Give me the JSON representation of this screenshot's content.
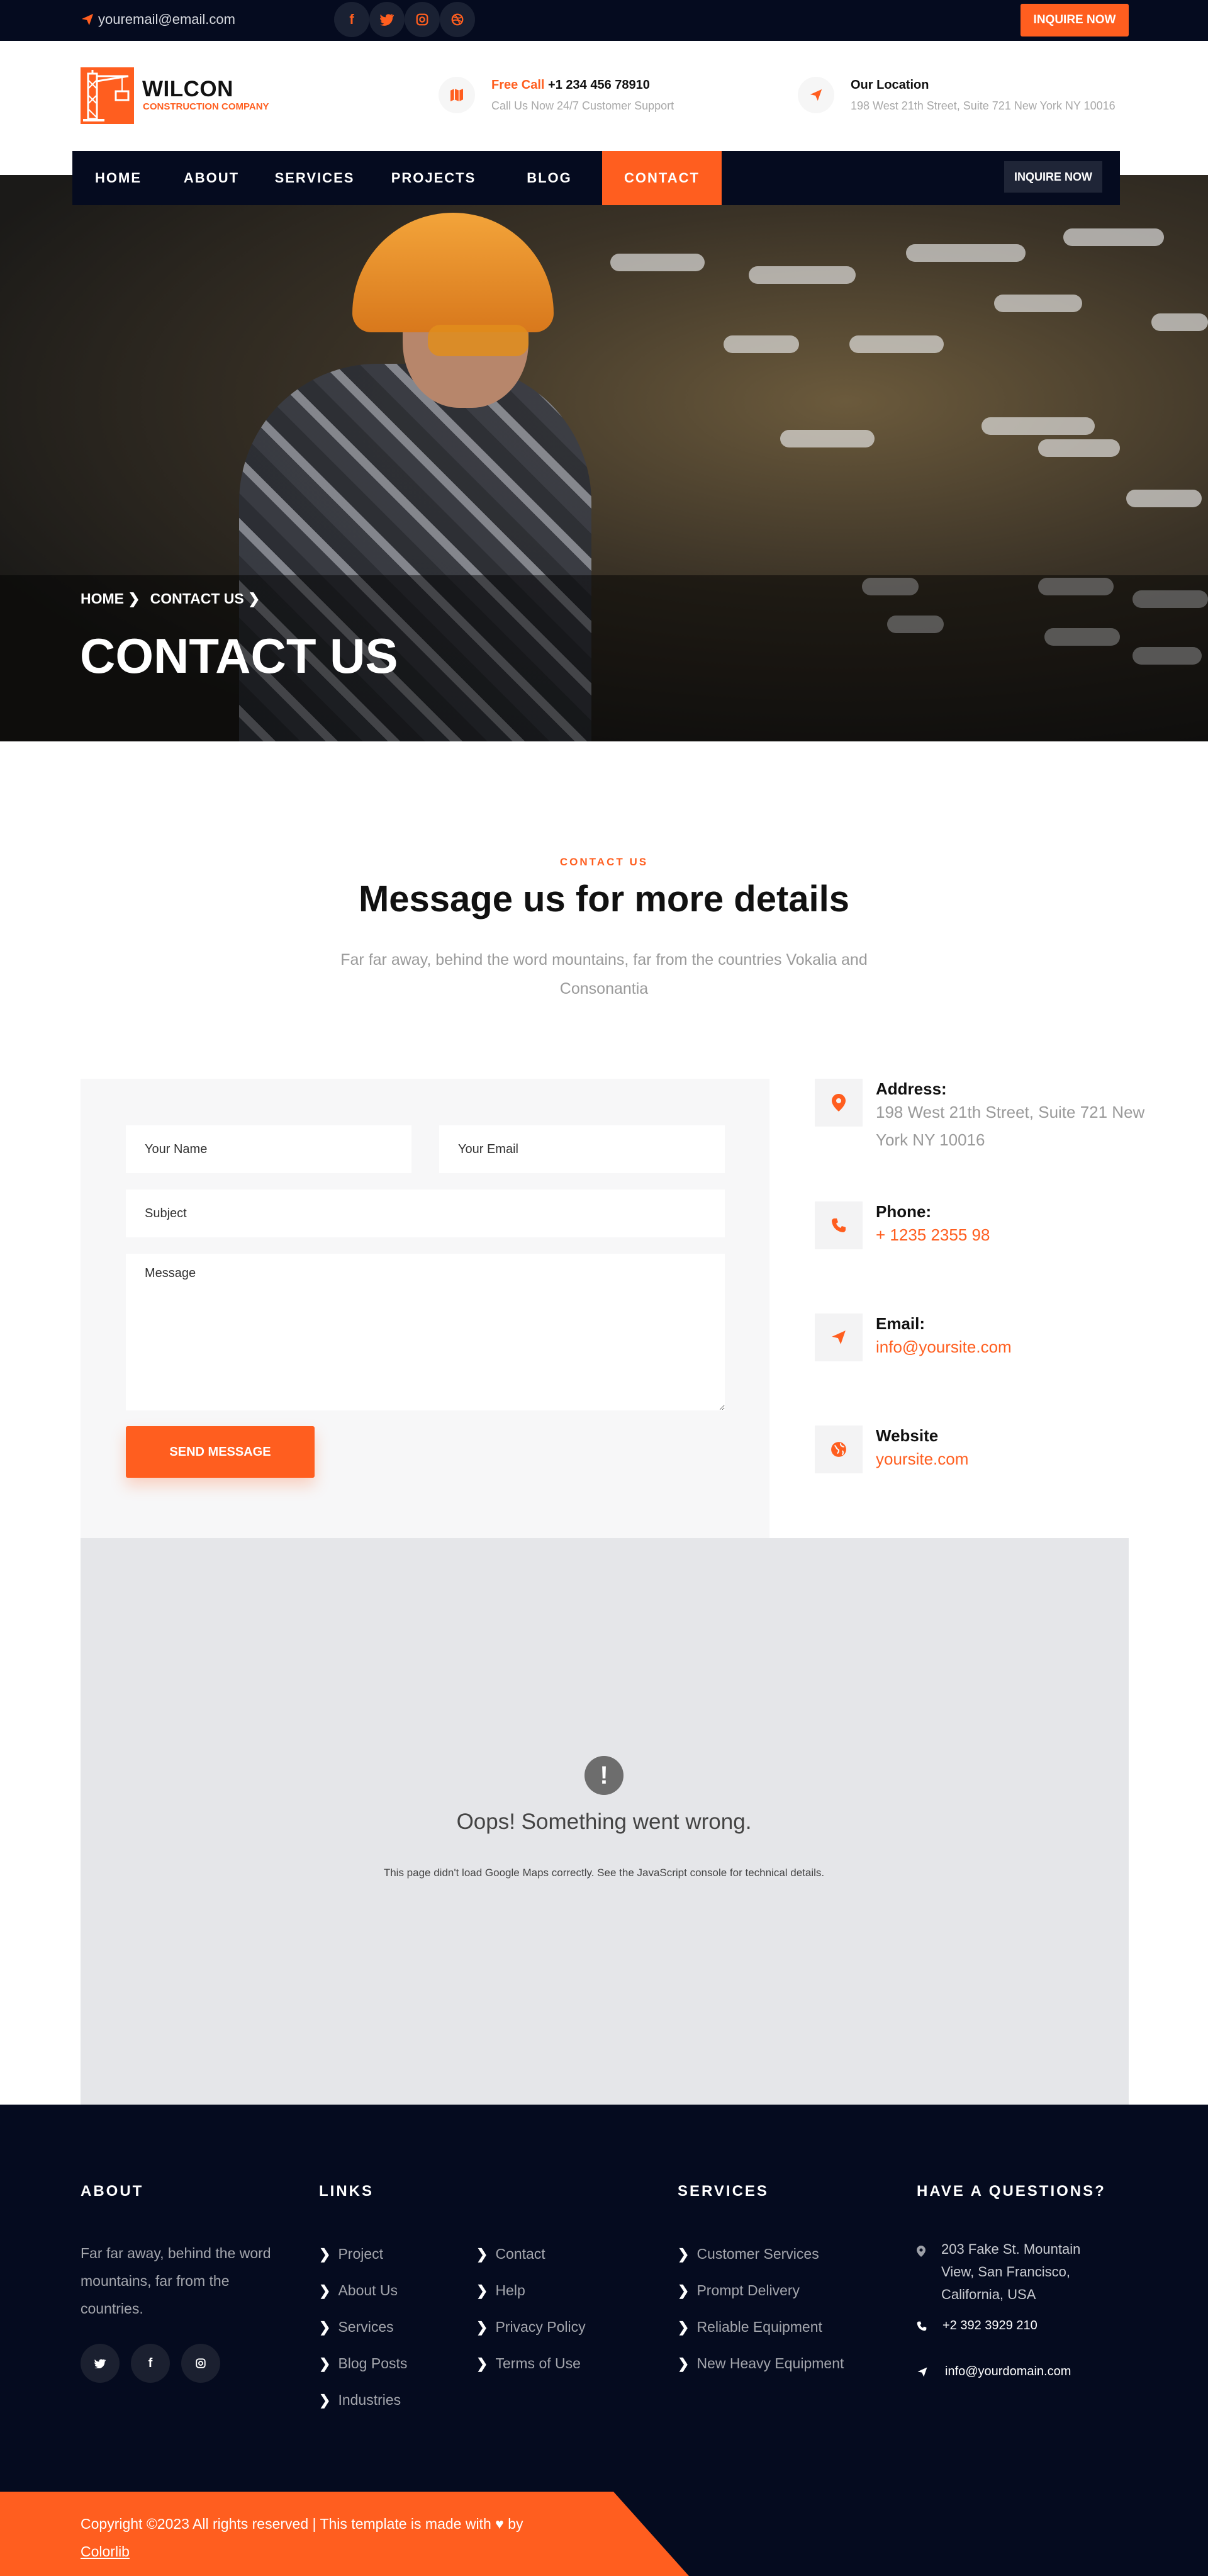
{
  "topbar": {
    "email": "youremail@email.com",
    "social": [
      "f",
      "t",
      "ig",
      "d"
    ],
    "inquire_label": "INQUIRE NOW"
  },
  "header": {
    "logo_title": "WILCON",
    "logo_sub": "CONSTRUCTION COMPANY",
    "call_prefix": "Free Call",
    "call_number": "+1 234 456 78910",
    "call_sub": "Call Us Now 24/7 Customer Support",
    "location_title": "Our Location",
    "location_sub": "198 West 21th Street, Suite 721 New York NY 10016"
  },
  "nav": {
    "items": [
      "HOME",
      "ABOUT",
      "SERVICES",
      "PROJECTS",
      "BLOG",
      "CONTACT"
    ],
    "active": "CONTACT",
    "inquire_label": "INQUIRE NOW"
  },
  "hero": {
    "breadcrumb_home": "HOME",
    "breadcrumb_current": "CONTACT US",
    "title": "CONTACT US"
  },
  "section": {
    "label": "CONTACT US",
    "title": "Message us for more details",
    "desc": "Far far away, behind the word mountains, far from the countries Vokalia and Consonantia"
  },
  "form": {
    "name_placeholder": "Your Name",
    "email_placeholder": "Your Email",
    "subject_placeholder": "Subject",
    "message_placeholder": "Message",
    "send_label": "SEND MESSAGE"
  },
  "contact_info": {
    "address_label": "Address:",
    "address_value": "198 West 21th Street, Suite 721 New York NY 10016",
    "phone_label": "Phone:",
    "phone_value": "+ 1235 2355 98",
    "email_label": "Email:",
    "email_value": "info@yoursite.com",
    "website_label": "Website",
    "website_value": "yoursite.com"
  },
  "map": {
    "title": "Oops! Something went wrong.",
    "desc": "This page didn't load Google Maps correctly. See the JavaScript console for technical details."
  },
  "footer": {
    "about_head": "ABOUT",
    "about_text": "Far far away, behind the word mountains, far from the countries.",
    "links_head": "LINKS",
    "links_col1": [
      "Project",
      "About Us",
      "Services",
      "Blog Posts",
      "Industries"
    ],
    "links_col2": [
      "Contact",
      "Help",
      "Privacy Policy",
      "Terms of Use"
    ],
    "services_head": "SERVICES",
    "services": [
      "Customer Services",
      "Prompt Delivery",
      "Reliable Equipment",
      "New Heavy Equipment"
    ],
    "questions_head": "HAVE A QUESTIONS?",
    "q_address": "203 Fake St. Mountain View, San Francisco, California, USA",
    "q_phone": "+2 392 3929 210",
    "q_email": "info@yourdomain.com",
    "copyright": "Copyright ©2023 All rights reserved | This template is made with",
    "copyright_by": "by",
    "copyright_link": "Colorlib"
  },
  "colors": {
    "accent": "#ff5e1f",
    "dark": "#050b1f"
  }
}
